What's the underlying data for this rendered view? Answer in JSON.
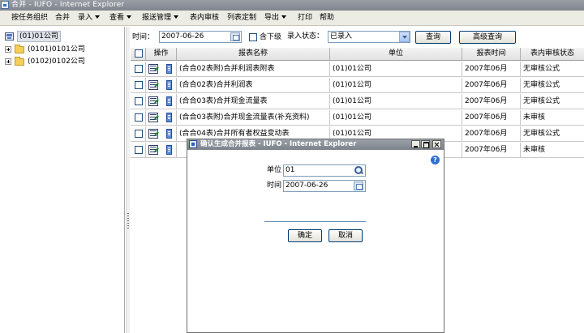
{
  "window": {
    "title": "合并 - IUFO - Internet Explorer"
  },
  "menu": [
    {
      "label": "按任务组织",
      "has_dropdown": false
    },
    {
      "label": "合并",
      "has_dropdown": false
    },
    {
      "label": "录入",
      "has_dropdown": true
    },
    {
      "label": "查看",
      "has_dropdown": true
    },
    {
      "label": "报送管理",
      "has_dropdown": true
    },
    {
      "label": "表内审核",
      "has_dropdown": false
    },
    {
      "label": "列表定制",
      "has_dropdown": false
    },
    {
      "label": "导出",
      "has_dropdown": true
    },
    {
      "label": "打印",
      "has_dropdown": false
    },
    {
      "label": "帮助",
      "has_dropdown": false
    }
  ],
  "tree": {
    "root": {
      "label": "(01)01公司"
    },
    "children": [
      {
        "label": "(0101)0101公司"
      },
      {
        "label": "(0102)0102公司"
      }
    ]
  },
  "filter": {
    "time_label": "时间：",
    "time_value": "2007-06-26",
    "include_sub_label": "含下级",
    "status_label": "录入状态：",
    "status_value": "已录入",
    "query_button": "查询",
    "advanced_query_button": "高级查询"
  },
  "table": {
    "headers": [
      "",
      "操作",
      "报表名称",
      "单位",
      "报表时间",
      "表内审核状态"
    ],
    "rows": [
      {
        "name": "(合合02表附)合并利润表附表",
        "unit": "(01)01公司",
        "time": "2007年06月",
        "status": "无审核公式"
      },
      {
        "name": "(合合02表)合并利润表",
        "unit": "(01)01公司",
        "time": "2007年06月",
        "status": "无审核公式"
      },
      {
        "name": "(合合03表)合并现金流量表",
        "unit": "(01)01公司",
        "time": "2007年06月",
        "status": "无审核公式"
      },
      {
        "name": "(合合03表附)合并现金流量表(补充资料)",
        "unit": "(01)01公司",
        "time": "2007年06月",
        "status": "未审核"
      },
      {
        "name": "(合合04表)合并所有者权益变动表",
        "unit": "(01)01公司",
        "time": "2007年06月",
        "status": "无审核公式"
      },
      {
        "name": "",
        "unit": "",
        "time": "2007年06月",
        "status": "未审核"
      }
    ]
  },
  "dialog": {
    "title": "确认生成合并报表 - IUFO - Internet Explorer",
    "unit_label": "单位",
    "unit_value": "01",
    "time_label": "时间",
    "time_value": "2007-06-26",
    "ok_button": "确定",
    "cancel_button": "取消",
    "help_glyph": "?"
  }
}
